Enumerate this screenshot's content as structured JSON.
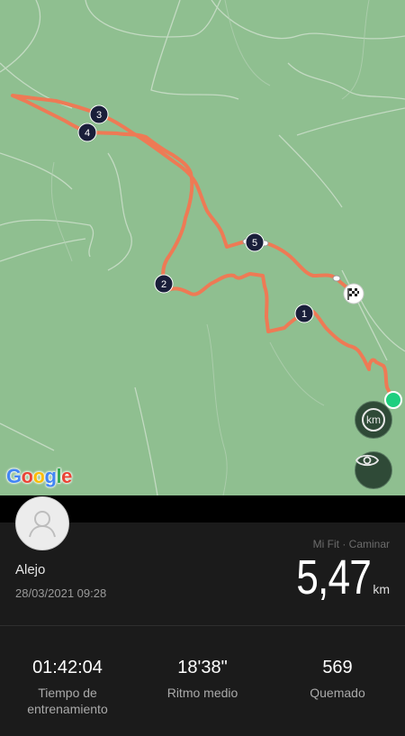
{
  "map": {
    "logo_text": "Google",
    "lap_markers": [
      "1",
      "2",
      "3",
      "4",
      "5"
    ],
    "km_button_label": "km",
    "icons": [
      "finish-flag-icon",
      "eye-icon",
      "start-point-icon"
    ]
  },
  "user": {
    "name": "Alejo",
    "datetime": "28/03/2021 09:28"
  },
  "activity": {
    "source": "Mi Fit · Caminar",
    "distance": "5,47",
    "distance_unit": "km"
  },
  "stats": [
    {
      "value": "01:42:04",
      "label": "Tiempo de entrenamiento"
    },
    {
      "value": "18'38\"",
      "label": "Ritmo medio"
    },
    {
      "value": "569",
      "label": "Quemado"
    }
  ],
  "colors": {
    "map_bg": "#8fbf90",
    "route": "#ee7a55",
    "start_point": "#1fcf7f",
    "panel_bg": "#1b1b1b"
  }
}
